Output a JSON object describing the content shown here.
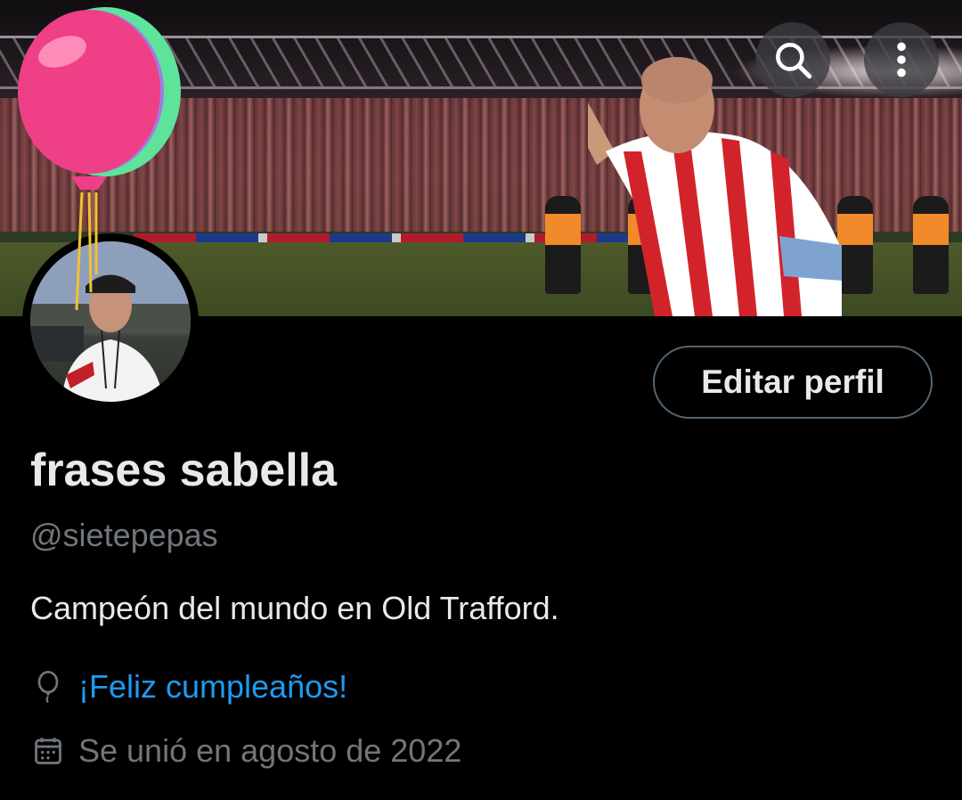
{
  "header": {
    "search_icon": "search-icon",
    "more_icon": "more-vertical-icon"
  },
  "profile": {
    "display_name": "frases sabella",
    "handle": "@sietepepas",
    "bio": "Campeón del mundo en Old Trafford.",
    "birthday_text": "¡Feliz cumpleaños!",
    "joined_text": "Se unió en agosto de 2022",
    "edit_button_label": "Editar perfil"
  },
  "colors": {
    "background": "#000000",
    "text_primary": "#e7e9ea",
    "text_secondary": "#71767b",
    "link": "#1d9bf0",
    "button_border": "#536471"
  }
}
